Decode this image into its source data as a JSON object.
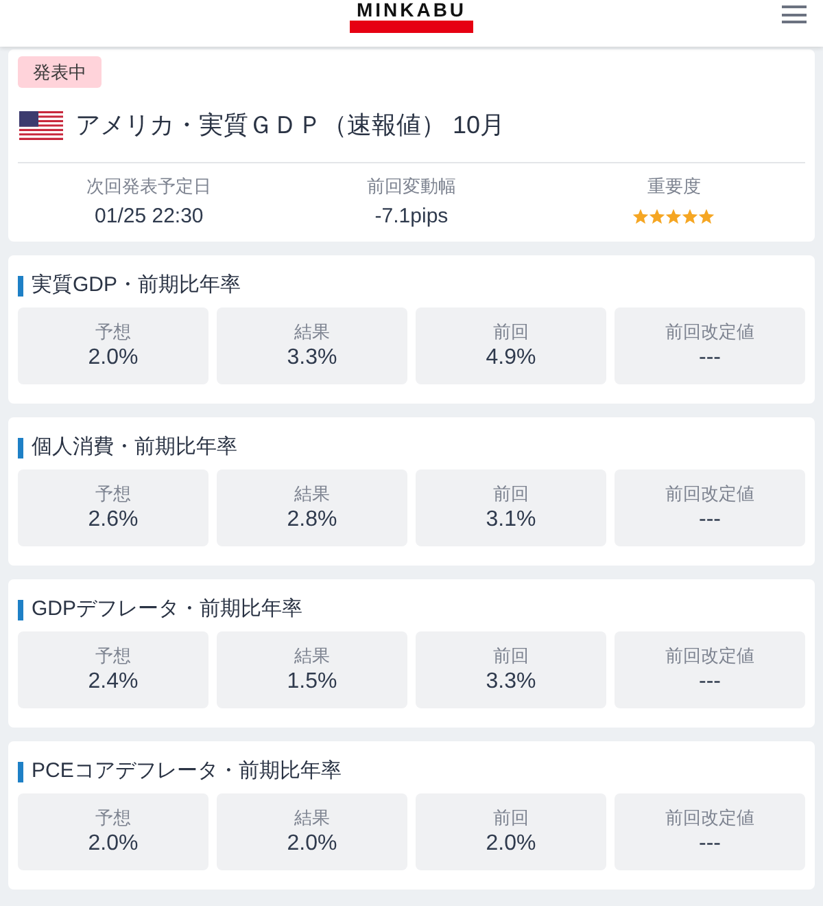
{
  "header": {
    "logo": "MINKABU"
  },
  "event": {
    "status_badge": "発表中",
    "title": "アメリカ・実質ＧＤＰ（速報値） 10月",
    "stats": [
      {
        "kind": "text",
        "label": "次回発表予定日",
        "value": "01/25 22:30"
      },
      {
        "kind": "text",
        "label": "前回変動幅",
        "value": "-7.1pips"
      },
      {
        "kind": "stars",
        "label": "重要度",
        "stars": 5
      }
    ]
  },
  "indicators": [
    {
      "title": "実質GDP・前期比年率",
      "cells": [
        {
          "label": "予想",
          "value": "2.0%"
        },
        {
          "label": "結果",
          "value": "3.3%"
        },
        {
          "label": "前回",
          "value": "4.9%"
        },
        {
          "label": "前回改定値",
          "value": "---"
        }
      ]
    },
    {
      "title": "個人消費・前期比年率",
      "cells": [
        {
          "label": "予想",
          "value": "2.6%"
        },
        {
          "label": "結果",
          "value": "2.8%"
        },
        {
          "label": "前回",
          "value": "3.1%"
        },
        {
          "label": "前回改定値",
          "value": "---"
        }
      ]
    },
    {
      "title": "GDPデフレータ・前期比年率",
      "cells": [
        {
          "label": "予想",
          "value": "2.4%"
        },
        {
          "label": "結果",
          "value": "1.5%"
        },
        {
          "label": "前回",
          "value": "3.3%"
        },
        {
          "label": "前回改定値",
          "value": "---"
        }
      ]
    },
    {
      "title": "PCEコアデフレータ・前期比年率",
      "cells": [
        {
          "label": "予想",
          "value": "2.0%"
        },
        {
          "label": "結果",
          "value": "2.0%"
        },
        {
          "label": "前回",
          "value": "2.0%"
        },
        {
          "label": "前回改定値",
          "value": "---"
        }
      ]
    }
  ]
}
